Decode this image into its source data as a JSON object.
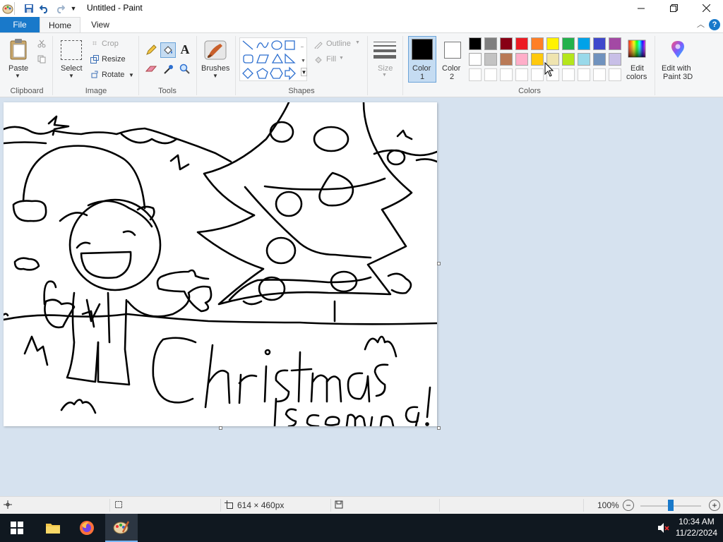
{
  "window": {
    "title": "Untitled - Paint"
  },
  "tabs": {
    "file": "File",
    "home": "Home",
    "view": "View"
  },
  "help": "?",
  "ribbon": {
    "clipboard": {
      "paste": "Paste",
      "group": "Clipboard"
    },
    "image": {
      "select": "Select",
      "crop": "Crop",
      "resize": "Resize",
      "rotate": "Rotate",
      "group": "Image"
    },
    "tools": {
      "group": "Tools",
      "text_tool": "A"
    },
    "brushes": {
      "label": "Brushes"
    },
    "shapes": {
      "outline": "Outline",
      "fill": "Fill",
      "group": "Shapes"
    },
    "size": {
      "label": "Size"
    },
    "colors": {
      "color1": "Color\n1",
      "color1_line1": "Color",
      "color1_line2": "1",
      "color2_line1": "Color",
      "color2_line2": "2",
      "edit_colors_line1": "Edit",
      "edit_colors_line2": "colors",
      "paint3d_line1": "Edit with",
      "paint3d_line2": "Paint 3D",
      "group": "Colors",
      "color1_value": "#000000",
      "color2_value": "#ffffff",
      "palette_row1": [
        "#000000",
        "#7f7f7f",
        "#880015",
        "#ed1c24",
        "#ff7f27",
        "#fff200",
        "#22b14c",
        "#00a2e8",
        "#3f48cc",
        "#a349a4"
      ],
      "palette_row2": [
        "#ffffff",
        "#c3c3c3",
        "#b97a57",
        "#ffaec9",
        "#ffc90e",
        "#efe4b0",
        "#b5e61d",
        "#99d9ea",
        "#7092be",
        "#c8bfe7"
      ]
    }
  },
  "canvas": {
    "text_main": "Christmas",
    "text_sub": "is coming!"
  },
  "status": {
    "dimensions": "614 × 460px",
    "zoom": "100%",
    "zoom_level": 0.5
  },
  "taskbar": {
    "time": "10:34 AM",
    "date": "11/22/2024"
  }
}
